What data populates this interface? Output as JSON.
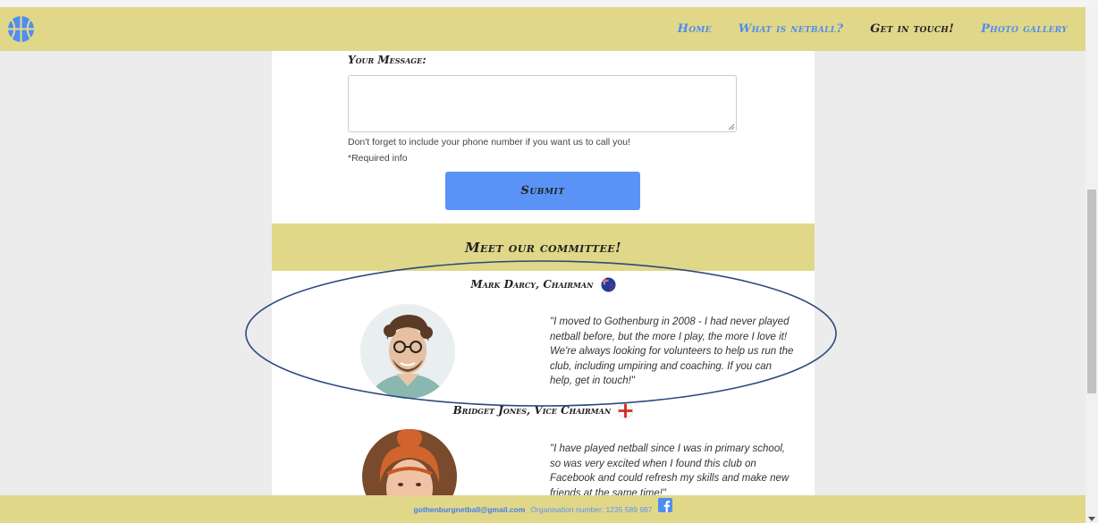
{
  "nav": {
    "items": [
      "Home",
      "What is netball?",
      "Get in touch!",
      "Photo gallery"
    ],
    "active_index": 2
  },
  "icons": {
    "logo": "basketball-icon",
    "facebook": "facebook-icon",
    "flag_nz": "new-zealand-flag-icon",
    "flag_england": "england-flag-icon"
  },
  "form": {
    "message_label": "Your Message:",
    "message_value": "",
    "hint": "Don't forget to include your phone number if you want us to call you!",
    "required_note": "*Required info",
    "submit_label": "Submit"
  },
  "committee": {
    "title": "Meet our committee!",
    "members": [
      {
        "name": "Mark Darcy, Chairman",
        "flag": "new-zealand-flag-icon",
        "quote": "\"I moved to Gothenburg in 2008 - I had never played netball before, but the more I play, the more I love it! We're always looking for volunteers to help us run the club, including umpiring and coaching. If you can help, get in touch!\""
      },
      {
        "name": "Bridget Jones, Vice Chairman",
        "flag": "england-flag-icon",
        "quote": "\"I have played netball since I was in primary school, so was very excited when I found this club on Facebook and could refresh my skills and make new friends at the same time!\""
      }
    ]
  },
  "footer": {
    "email": "gothenburgnetball@gmail.com",
    "org_number": "Organisation number: 1235 589 987"
  },
  "colors": {
    "band": "#e1d789",
    "link": "#4f8df0",
    "button": "#5a93f5",
    "annotation": "#2c4a7c",
    "background": "#ececec"
  }
}
